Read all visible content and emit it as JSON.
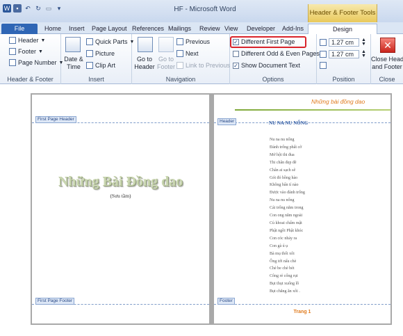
{
  "window": {
    "title": "HF - Microsoft Word",
    "context_tab_title": "Header & Footer Tools"
  },
  "tabs": [
    {
      "label": "File"
    },
    {
      "label": "Home"
    },
    {
      "label": "Insert"
    },
    {
      "label": "Page Layout"
    },
    {
      "label": "References"
    },
    {
      "label": "Mailings"
    },
    {
      "label": "Review"
    },
    {
      "label": "View"
    },
    {
      "label": "Developer"
    },
    {
      "label": "Add-Ins"
    },
    {
      "label": "Design"
    }
  ],
  "ribbon": {
    "header_footer": {
      "header": "Header",
      "footer": "Footer",
      "page_number": "Page Number",
      "label": "Header & Footer"
    },
    "insert": {
      "date_time_1": "Date &",
      "date_time_2": "Time",
      "quick_parts": "Quick Parts",
      "picture": "Picture",
      "clip_art": "Clip Art",
      "label": "Insert"
    },
    "navigation": {
      "goto_header_1": "Go to",
      "goto_header_2": "Header",
      "goto_footer_1": "Go to",
      "goto_footer_2": "Footer",
      "previous": "Previous",
      "next": "Next",
      "link_to_previous": "Link to Previous",
      "label": "Navigation"
    },
    "options": {
      "different_first_page": "Different First Page",
      "different_odd_even": "Different Odd & Even Pages",
      "show_document_text": "Show Document Text",
      "label": "Options",
      "different_first_page_checked": true,
      "different_odd_even_checked": false,
      "show_document_text_checked": true
    },
    "position": {
      "header_from_top": "1.27 cm",
      "footer_from_bottom": "1.27 cm",
      "label": "Position"
    },
    "close": {
      "close_1": "Close Header",
      "close_2": "and Footer",
      "label": "Close"
    }
  },
  "document": {
    "page1": {
      "header_tag": "First Page Header",
      "footer_tag": "First Page Footer",
      "title": "Những Bài Đồng dao",
      "subtitle": "(Sưu tầm)"
    },
    "page2": {
      "header_tag": "Header",
      "footer_tag": "Footer",
      "header_text": "Những bài đồng dao",
      "poem_title": "NU NA NU NỐNG",
      "poem_lines": [
        "Nu na nu nống",
        "Đánh trống phất cờ",
        "Mở hội thi đua",
        "Thi chân đẹp đẽ",
        "Chân ai sạch sẽ",
        "Gót đỏ hồng hào",
        "Không bẩn tí nào",
        "Được vào đánh trống",
        "Nu na nu nống",
        "Cái trống nằm trong",
        "Con ong nằm ngoài",
        "Củ khoai chấm mật",
        "Phật ngồi Phật khóc",
        "Con cóc nhảy ra",
        "Con gà ú ụ",
        "Bà mụ thổi xôi",
        "Ông tới nấu chè",
        "Chè be chè bét",
        "Công rẻ cổng rụt",
        "Bụt thụt xuống lỗ",
        "Bụt chẳng ăn xôi ."
      ],
      "page_number": "Trang 1"
    }
  },
  "colors": {
    "title_bar": "#c9d8ee",
    "file_tab": "#2f66b5",
    "context_tab": "#e9c95b",
    "highlight_box": "#d9232a",
    "header_text": "#e07a1d",
    "poem_title": "#2f5aa3"
  }
}
